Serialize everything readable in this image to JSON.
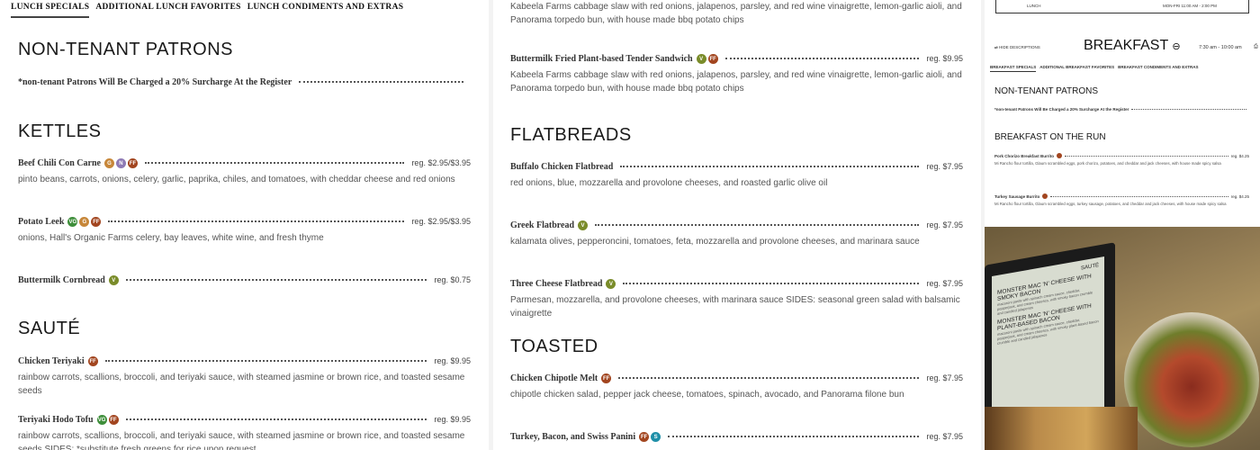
{
  "colors": {
    "badge_gf": "#c7873a",
    "badge_v": "#7a8c2a",
    "badge_vg": "#3e8e3a",
    "badge_n": "#8e7ab5",
    "badge_ff": "#a2451f",
    "badge_s": "#1f8fa8"
  },
  "left_panel": {
    "tabs": [
      "LUNCH SPECIALS",
      "ADDITIONAL LUNCH FAVORITES",
      "LUNCH CONDIMENTS AND EXTRAS"
    ],
    "sections": [
      {
        "heading": "NON-TENANT PATRONS",
        "items": [
          {
            "name": "*non-tenant Patrons Will Be Charged a 20% Surcharge At the Register",
            "badges": [],
            "price": "",
            "desc": ""
          }
        ]
      },
      {
        "heading": "KETTLES",
        "items": [
          {
            "name": "Beef Chili Con Carne",
            "badges": [
              {
                "icon": "gluten-free-icon",
                "t": "G"
              },
              {
                "icon": "nut-icon",
                "t": "N"
              },
              {
                "icon": "farm-fresh-icon",
                "t": "FF"
              }
            ],
            "price": "reg. $2.95/$3.95",
            "desc": "pinto beans, carrots, onions, celery, garlic, paprika, chiles, and tomatoes, with cheddar cheese and red onions"
          },
          {
            "name": "Potato Leek",
            "badges": [
              {
                "icon": "vegan-icon",
                "t": "VG"
              },
              {
                "icon": "gluten-free-icon",
                "t": "G"
              },
              {
                "icon": "farm-fresh-icon",
                "t": "FF"
              }
            ],
            "price": "reg. $2.95/$3.95",
            "desc": "onions, Hall's Organic Farms celery, bay leaves, white wine, and fresh thyme"
          },
          {
            "name": "Buttermilk Cornbread",
            "badges": [
              {
                "icon": "vegetarian-icon",
                "t": "V"
              }
            ],
            "price": "reg. $0.75",
            "desc": ""
          }
        ]
      },
      {
        "heading": "SAUTÉ",
        "items": [
          {
            "name": "Chicken Teriyaki",
            "badges": [
              {
                "icon": "farm-fresh-icon",
                "t": "FF"
              }
            ],
            "price": "reg. $9.95",
            "desc": "rainbow carrots, scallions, broccoli, and teriyaki sauce, with steamed jasmine or brown rice, and toasted sesame seeds"
          },
          {
            "name": "Teriyaki Hodo Tofu",
            "badges": [
              {
                "icon": "vegan-icon",
                "t": "VG"
              },
              {
                "icon": "farm-fresh-icon",
                "t": "FF"
              }
            ],
            "price": "reg. $9.95",
            "desc": "rainbow carrots, scallions, broccoli, and teriyaki sauce, with steamed jasmine or brown rice, and toasted sesame seeds SIDES: *substitute fresh greens for rice upon request"
          }
        ]
      }
    ]
  },
  "middle_panel": {
    "top_desc": "Kabeela Farms cabbage slaw with red onions, jalapenos, parsley, and red wine vinaigrette, lemon-garlic aioli, and Panorama torpedo bun, with house made bbq potato chips",
    "sandwich": {
      "name": "Buttermilk Fried Plant-based Tender Sandwich",
      "badges": [
        {
          "icon": "vegetarian-icon",
          "t": "V"
        },
        {
          "icon": "farm-fresh-icon",
          "t": "FF"
        }
      ],
      "price": "reg. $9.95",
      "desc": "Kabeela Farms cabbage slaw with red onions, jalapenos, parsley, and red wine vinaigrette, lemon-garlic aioli, and Panorama torpedo bun, with house made bbq potato chips"
    },
    "sections": [
      {
        "heading": "FLATBREADS",
        "items": [
          {
            "name": "Buffalo Chicken Flatbread",
            "badges": [],
            "price": "reg. $7.95",
            "desc": "red onions, blue, mozzarella and provolone cheeses, and roasted garlic olive oil"
          },
          {
            "name": "Greek Flatbread",
            "badges": [
              {
                "icon": "vegetarian-icon",
                "t": "V"
              }
            ],
            "price": "reg. $7.95",
            "desc": "kalamata olives, pepperoncini, tomatoes, feta, mozzarella and provolone cheeses, and marinara sauce"
          },
          {
            "name": "Three Cheese Flatbread",
            "badges": [
              {
                "icon": "vegetarian-icon",
                "t": "V"
              }
            ],
            "price": "reg. $7.95",
            "desc": "Parmesan, mozzarella, and provolone cheeses, with marinara sauce SIDES: seasonal green salad with balsamic vinaigrette"
          }
        ]
      },
      {
        "heading": "TOASTED",
        "items": [
          {
            "name": "Chicken Chipotle Melt",
            "badges": [
              {
                "icon": "farm-fresh-icon",
                "t": "FF"
              }
            ],
            "price": "reg. $7.95",
            "desc": "chipotle chicken salad, pepper jack cheese, tomatoes, spinach, avocado, and Panorama filone bun"
          },
          {
            "name": "Turkey, Bacon, and Swiss Panini",
            "badges": [
              {
                "icon": "farm-fresh-icon",
                "t": "FF"
              },
              {
                "icon": "seafood-icon",
                "t": "S"
              }
            ],
            "price": "reg. $7.95",
            "desc": ""
          }
        ]
      }
    ]
  },
  "right_panel": {
    "top_label_lunch": "LUNCH",
    "top_label_time": "MON-FRI 11:00 AM - 2:00 PM",
    "hide_descriptions": "HIDE DESCRIPTIONS",
    "title": "BREAKFAST",
    "hours": "7:30 am - 10:00 am",
    "tabs": [
      "BREAKFAST SPECIALS",
      "ADDITIONAL BREAKFAST FAVORITES",
      "BREAKFAST CONDIMENTS AND EXTRAS"
    ],
    "heading1": "NON-TENANT PATRONS",
    "surcharge": "*non-tenant Patrons Will Be Charged a 20% Surcharge At the Register",
    "heading2": "BREAKFAST ON THE RUN",
    "items": [
      {
        "name": "Pork Chorizo Breakfast Burrito",
        "price": "reg. $4.25",
        "desc": "Mi Rancho flour tortilla, Glaum scrambled eggs, pork chorizo, potatoes, and cheddar and jack cheeses, with house made spicy salsa"
      },
      {
        "name": "Turkey Sausage Burrito",
        "price": "reg. $4.25",
        "desc": "Mi Rancho flour tortilla, Glaum scrambled eggs, turkey sausage, potatoes, and cheddar and jack cheeses, with house made spicy salsa"
      }
    ],
    "photo": {
      "screen_title": "SAUTÉ",
      "screen_item1": "MONSTER MAC 'N' CHEESE WITH SMOKY BACON",
      "screen_desc1": "macaroni pasta with spinach cream sauce, cheddar, pepperjack, and cream cheeses, with smoky bacon crumble and candied jalapenos",
      "screen_item2": "MONSTER MAC 'N' CHEESE WITH PLANT-BASED BACON",
      "screen_desc2": "macaroni pasta with spinach cream sauce, cheddar, pepperjack, and cream cheeses, with smoky plant-based bacon crumble and candied jalapenos"
    }
  }
}
